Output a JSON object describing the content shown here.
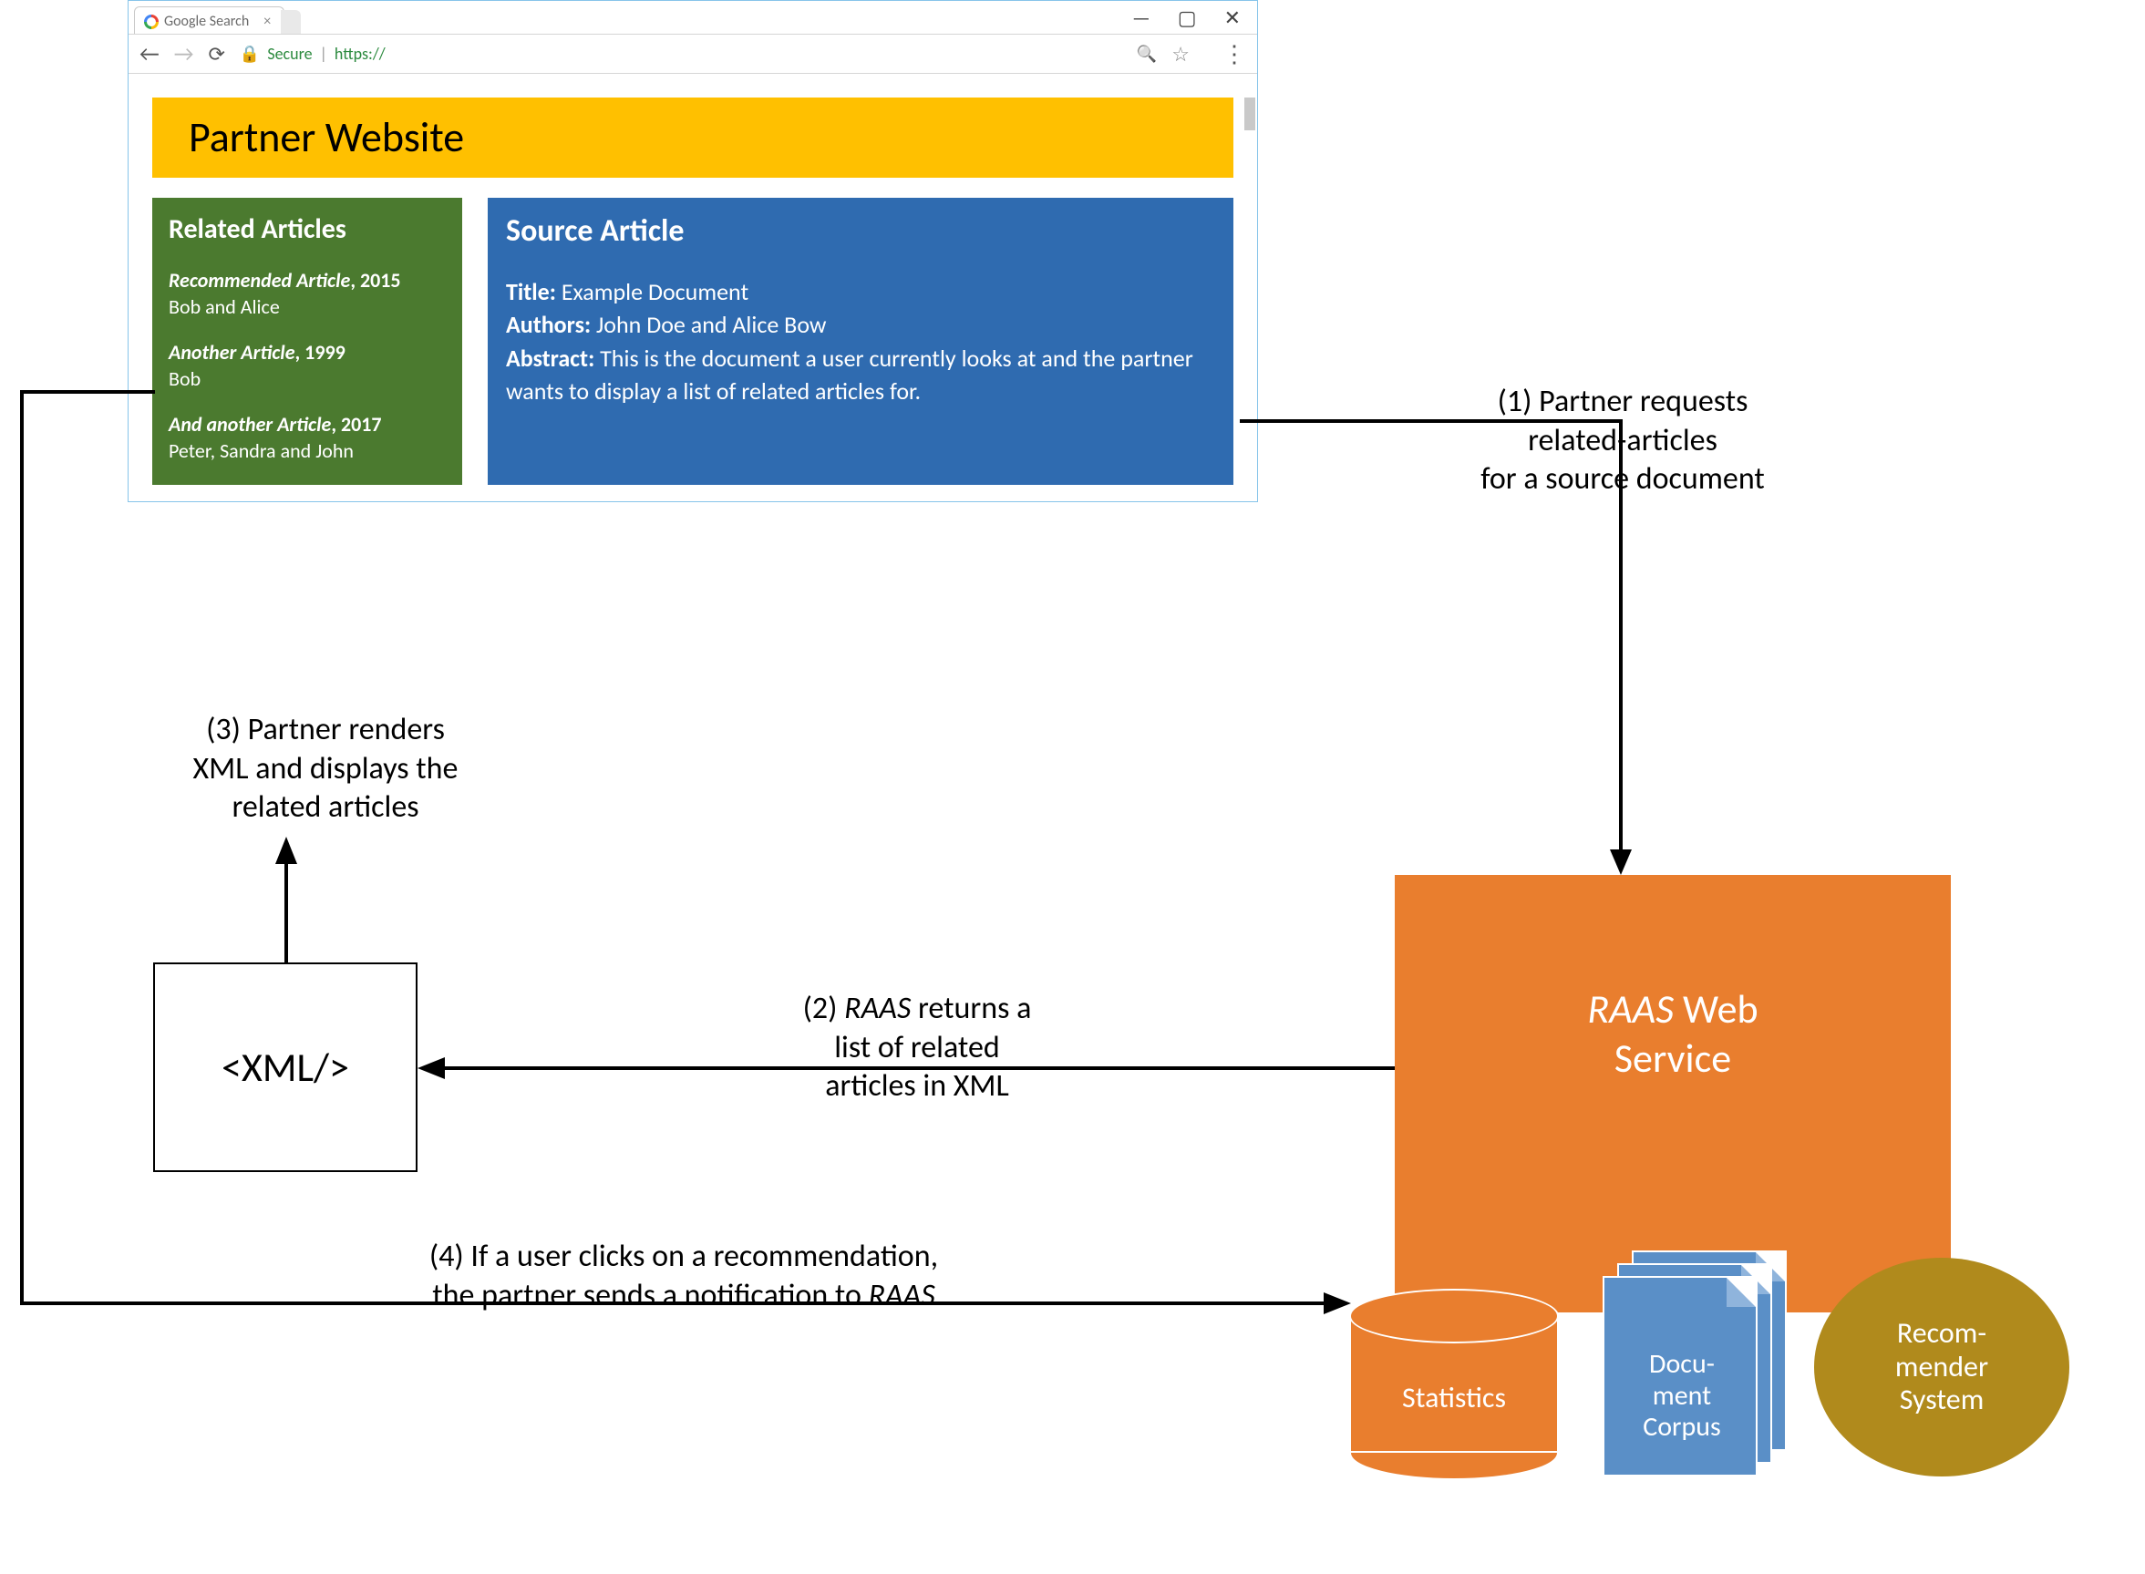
{
  "browser": {
    "tab_title": "Google Search",
    "tab_close": "×",
    "win_min": "—",
    "win_max": "▢",
    "win_close": "✕",
    "back": "←",
    "forward": "→",
    "reload": "⟳",
    "secure": "Secure",
    "https": "https://",
    "zoom": "🔍",
    "star": "☆",
    "menu": "⋮"
  },
  "page": {
    "partner_header": "Partner Website",
    "related": {
      "heading": "Related Articles",
      "items": [
        {
          "title": "Recommended Article",
          "year": "2015",
          "authors": "Bob and Alice"
        },
        {
          "title": "Another Article",
          "year": "1999",
          "authors": "Bob"
        },
        {
          "title": "And another Article",
          "year": "2017",
          "authors": "Peter, Sandra and John"
        }
      ]
    },
    "source": {
      "heading": "Source Article",
      "title_label": "Title:",
      "title_value": "Example Document",
      "authors_label": "Authors:",
      "authors_value": "John Doe and Alice Bow",
      "abstract_label": "Abstract:",
      "abstract_value": "This is the document a user currently looks at and the partner wants to display a list of related articles for."
    }
  },
  "xml_box": "<XML/>",
  "raas": {
    "line1": "RAAS",
    "line2": "Web",
    "line3": "Service"
  },
  "stats_label": "Statistics",
  "doc_corpus_l1": "Docu-",
  "doc_corpus_l2": "ment",
  "doc_corpus_l3": "Corpus",
  "recom_l1": "Recom-",
  "recom_l2": "mender",
  "recom_l3": "System",
  "captions": {
    "c1_l1": "(1) Partner requests",
    "c1_l2": "related-articles",
    "c1_l3": "for a source document",
    "c2_l1": "(2) RAAS returns a",
    "c2_l2": "list of related",
    "c2_l3": "articles in XML",
    "c3_l1": "(3) Partner renders",
    "c3_l2": "XML and displays the",
    "c3_l3": "related articles",
    "c4_l1": "(4) If a user clicks on a recommendation,",
    "c4_l2": "the partner sends a notification to RAAS"
  }
}
